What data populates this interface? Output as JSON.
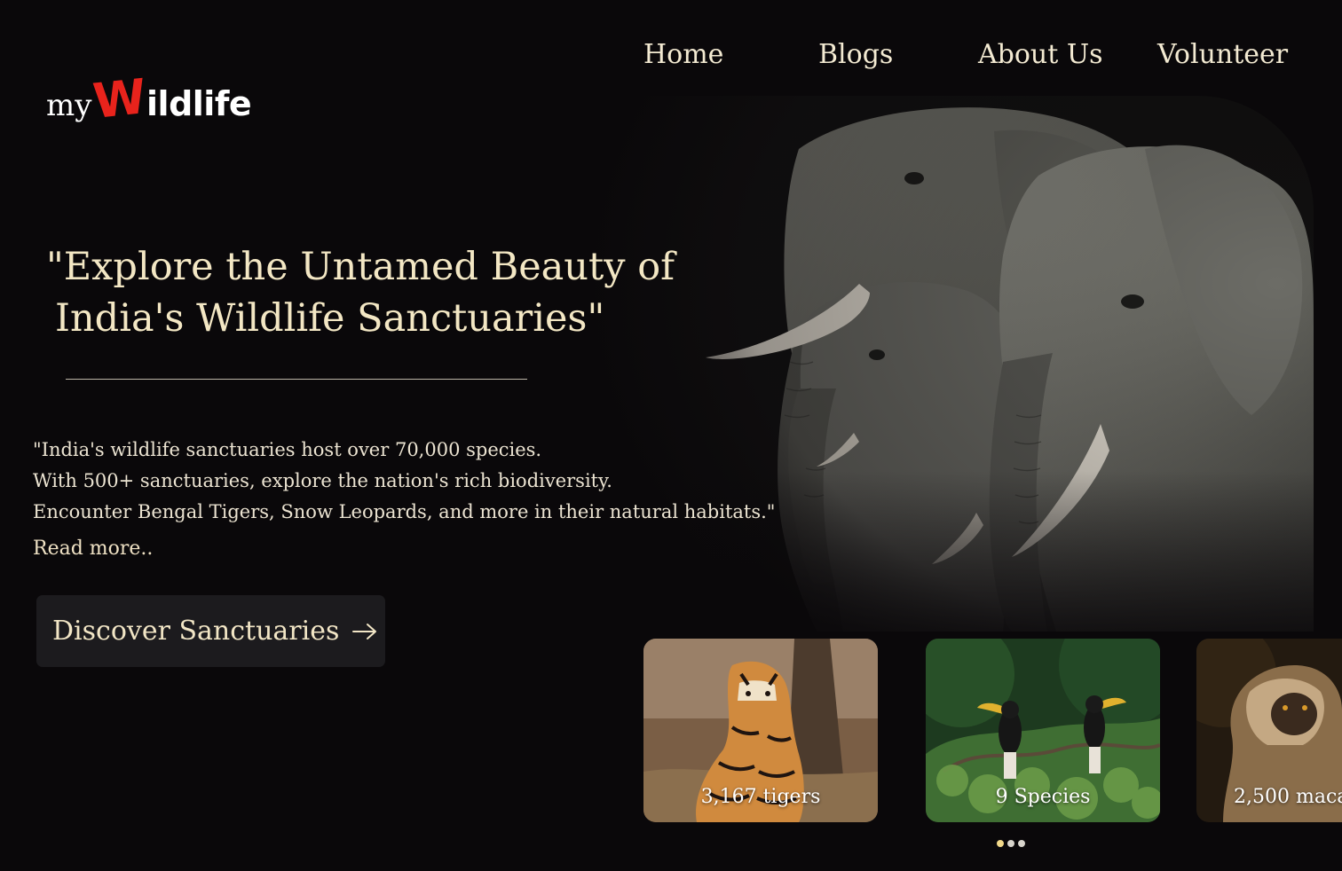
{
  "logo": {
    "prefix": "my",
    "initial": "W",
    "rest": "ildlife",
    "accent_color": "#e8231c"
  },
  "nav": {
    "items": [
      {
        "label": "Home"
      },
      {
        "label": "Blogs"
      },
      {
        "label": "About Us"
      },
      {
        "label": "Volunteer"
      }
    ]
  },
  "hero": {
    "headline_line1": "\"Explore the Untamed Beauty of",
    "headline_line2": "India's Wildlife Sanctuaries\"",
    "description": [
      "\"India's wildlife sanctuaries host over 70,000 species.",
      "With 500+ sanctuaries, explore the nation's rich biodiversity.",
      "Encounter Bengal Tigers, Snow Leopards, and more in their natural habitats.\""
    ],
    "read_more": "Read more..",
    "cta_label": "Discover Sanctuaries",
    "cta_icon": "arrow-right-icon",
    "image_subject": "elephants"
  },
  "cards": [
    {
      "label": "3,167 tigers",
      "image_subject": "tiger"
    },
    {
      "label": "9 Species",
      "image_subject": "hornbills"
    },
    {
      "label": "2,500 maca",
      "image_subject": "macaque"
    }
  ],
  "carousel": {
    "total": 3,
    "active_index": 0
  },
  "colors": {
    "background": "#0a080a",
    "text_cream": "#f3e7c4",
    "button_bg": "#1c1b1e",
    "active_dot": "#f2d98a"
  }
}
